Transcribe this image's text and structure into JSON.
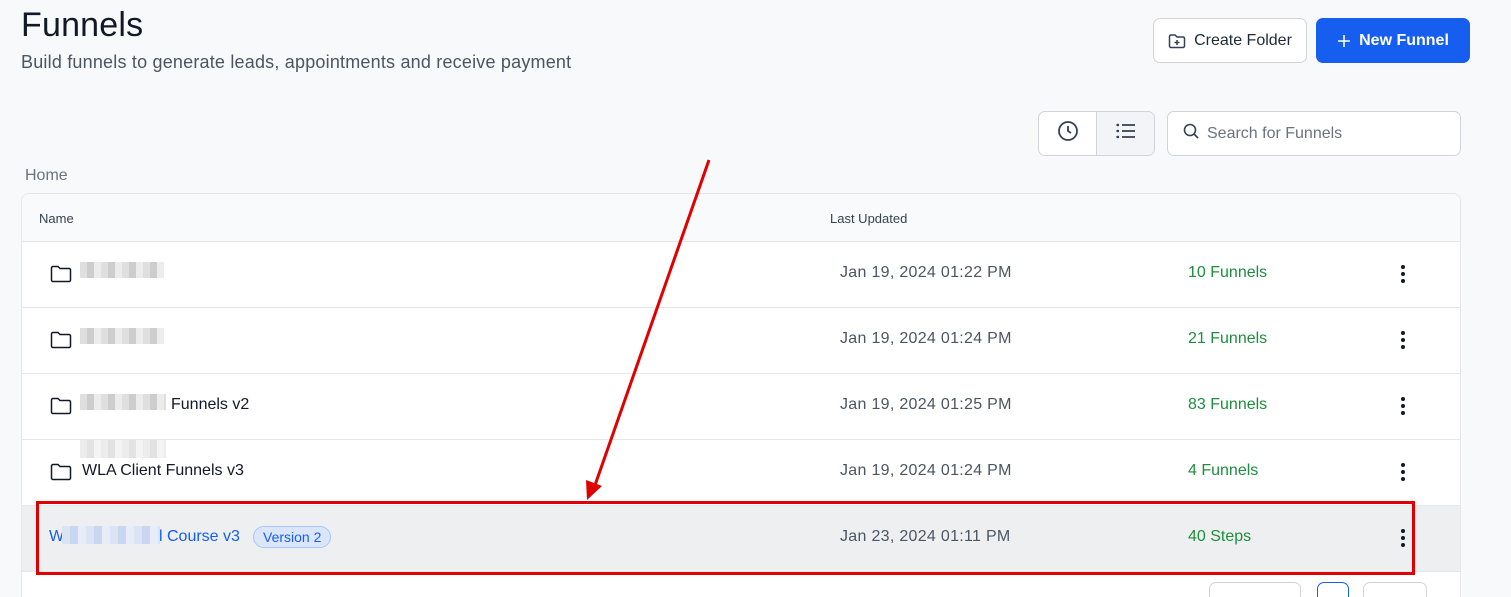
{
  "header": {
    "title": "Funnels",
    "subtitle": "Build funnels to generate leads, appointments and receive payment",
    "create_folder_label": "Create Folder",
    "new_funnel_label": "New Funnel"
  },
  "toolbar": {
    "search_placeholder": "Search for Funnels",
    "view_recent_icon": "clock-icon",
    "view_list_icon": "list-icon"
  },
  "breadcrumb": "Home",
  "table": {
    "columns": {
      "name": "Name",
      "last_updated": "Last Updated"
    },
    "rows": [
      {
        "type": "folder",
        "name": "",
        "last_updated": "Jan 19, 2024 01:22 PM",
        "count": "10 Funnels"
      },
      {
        "type": "folder",
        "name": "",
        "last_updated": "Jan 19, 2024 01:24 PM",
        "count": "21 Funnels"
      },
      {
        "type": "folder",
        "name": "Funnels v2",
        "last_updated": "Jan 19, 2024 01:25 PM",
        "count": "83 Funnels"
      },
      {
        "type": "folder",
        "name": "WLA Client Funnels v3",
        "last_updated": "Jan 19, 2024 01:24 PM",
        "count": "4 Funnels"
      },
      {
        "type": "funnel",
        "name_prefix": "W",
        "name": "l Course v3",
        "badge": "Version 2",
        "last_updated": "Jan 23, 2024 01:11 PM",
        "count": "40 Steps"
      }
    ]
  },
  "colors": {
    "primary": "#155eef",
    "success": "#1e8e3e",
    "annotation": "#e00000"
  }
}
